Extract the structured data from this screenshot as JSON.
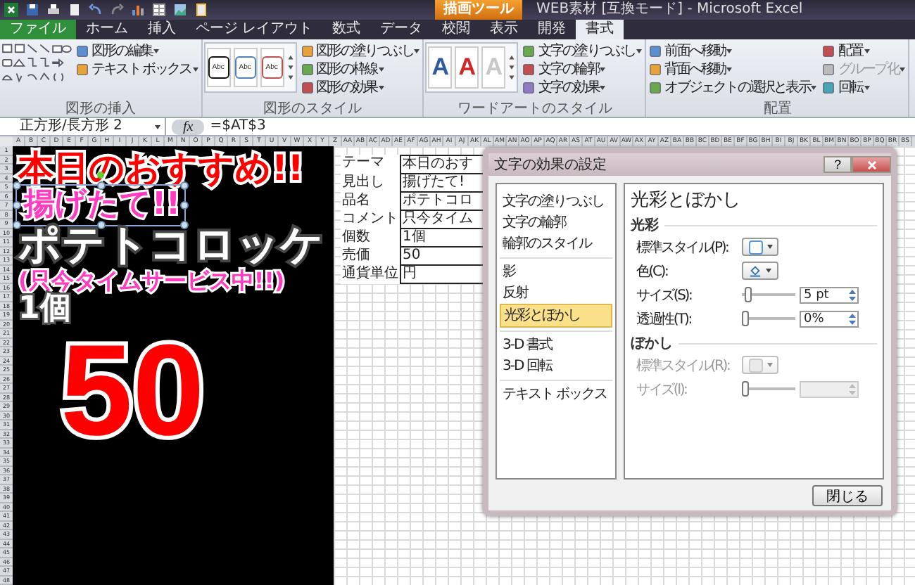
{
  "title_bar": {
    "context_tab": "描画ツール",
    "title": "WEB素材 [互換モード] - Microsoft Excel"
  },
  "tabs": [
    {
      "label": "ファイル",
      "kind": "file",
      "selected": false
    },
    {
      "label": "ホーム",
      "kind": "normal",
      "selected": false
    },
    {
      "label": "挿入",
      "kind": "normal",
      "selected": false
    },
    {
      "label": "ページ レイアウト",
      "kind": "normal",
      "selected": false
    },
    {
      "label": "数式",
      "kind": "normal",
      "selected": false
    },
    {
      "label": "データ",
      "kind": "normal",
      "selected": false
    },
    {
      "label": "校閲",
      "kind": "normal",
      "selected": false
    },
    {
      "label": "表示",
      "kind": "normal",
      "selected": false
    },
    {
      "label": "開発",
      "kind": "normal",
      "selected": false
    },
    {
      "label": "書式",
      "kind": "context",
      "selected": true
    }
  ],
  "ribbon": {
    "groups": [
      {
        "label": "図形の挿入",
        "kind": "shapes",
        "buttons": [
          {
            "label": "図形の編集"
          },
          {
            "label": "テキスト ボックス"
          }
        ]
      },
      {
        "label": "図形のスタイル",
        "kind": "styles",
        "swatches": [
          {
            "text": "Abc",
            "color": "#111111"
          },
          {
            "text": "Abc",
            "color": "#4f81bd"
          },
          {
            "text": "Abc",
            "color": "#c0504d"
          }
        ],
        "buttons": [
          {
            "label": "図形の塗りつぶし"
          },
          {
            "label": "図形の枠線"
          },
          {
            "label": "図形の効果"
          }
        ]
      },
      {
        "label": "ワードアートのスタイル",
        "kind": "wordart",
        "swatches": [
          {
            "text": "A",
            "color": "#2e5c9e"
          },
          {
            "text": "A",
            "color": "#d02828"
          },
          {
            "text": "A",
            "color": "#c8c8c8"
          }
        ],
        "buttons": [
          {
            "label": "文字の塗りつぶし"
          },
          {
            "label": "文字の輪郭"
          },
          {
            "label": "文字の効果"
          }
        ]
      },
      {
        "label": "配置",
        "kind": "arrange",
        "columns": [
          [
            {
              "label": "前面へ移動",
              "disabled": false
            },
            {
              "label": "背面へ移動",
              "disabled": false
            },
            {
              "label": "オブジェクトの選択と表示",
              "disabled": false
            }
          ],
          [
            {
              "label": "配置",
              "disabled": false
            },
            {
              "label": "グループ化",
              "disabled": true
            },
            {
              "label": "回転",
              "disabled": false
            }
          ]
        ]
      }
    ]
  },
  "formula_bar": {
    "name_box": "正方形/長方形 2",
    "function_button": "fx",
    "formula": "=$AT$3"
  },
  "sheet": {
    "columns": [
      "A",
      "B",
      "C",
      "D",
      "E",
      "F",
      "G",
      "H",
      "I",
      "J",
      "K",
      "L",
      "M",
      "N",
      "O",
      "P",
      "Q",
      "R",
      "S",
      "T",
      "U",
      "V",
      "W",
      "X",
      "Y",
      "Z",
      "AA",
      "AB",
      "AC",
      "AD",
      "AE",
      "AF",
      "AG",
      "AH",
      "AI",
      "AJ",
      "AK",
      "AL",
      "AM",
      "AN",
      "AO",
      "AP",
      "AQ",
      "AR",
      "AS",
      "AT",
      "AU",
      "AV",
      "AW",
      "AX",
      "AY",
      "AZ",
      "BA",
      "BB",
      "BC",
      "BD",
      "BE",
      "BF",
      "BG",
      "BH",
      "BI",
      "BJ",
      "BK",
      "BL",
      "BM",
      "BN",
      "BO",
      "BP",
      "BQ",
      "BR",
      "BS"
    ],
    "rows": [
      "1",
      "2",
      "3",
      "4",
      "5",
      "6",
      "7",
      "8",
      "9",
      "10",
      "11",
      "12",
      "13",
      "14",
      "15",
      "16",
      "17",
      "18",
      "19",
      "20",
      "21",
      "22",
      "23",
      "24",
      "25",
      "26",
      "27",
      "28",
      "29",
      "30",
      "31",
      "32",
      "33",
      "34",
      "35",
      "36",
      "37",
      "38",
      "39",
      "40",
      "41",
      "42",
      "43",
      "44",
      "45",
      "46",
      "47",
      "48"
    ],
    "poster": [
      {
        "text": "本日のおすすめ!!",
        "kind": "headline",
        "selected": false
      },
      {
        "text": "揚げたて!!",
        "kind": "tagline",
        "selected": true
      },
      {
        "text": "ポテトコロッケ",
        "kind": "product",
        "selected": false
      },
      {
        "text": "(只今タイムサービス中!!)",
        "kind": "note",
        "selected": false
      },
      {
        "text": "1個",
        "kind": "unit",
        "selected": false
      },
      {
        "text": "50",
        "kind": "price",
        "selected": false
      }
    ],
    "table": [
      {
        "label": "テーマ",
        "value": "本日のおす"
      },
      {
        "label": "見出し",
        "value": "揚げたて!"
      },
      {
        "label": "品名",
        "value": "ポテトコロ"
      },
      {
        "label": "コメント",
        "value": "只今タイム"
      },
      {
        "label": "個数",
        "value": "1個"
      },
      {
        "label": "売価",
        "value": "50"
      },
      {
        "label": "通貨単位",
        "value": "円"
      }
    ]
  },
  "dialog": {
    "title": "文字の効果の設定",
    "help": "?",
    "categories": [
      [
        {
          "label": "文字の塗りつぶし",
          "selected": false
        },
        {
          "label": "文字の輪郭",
          "selected": false
        },
        {
          "label": "輪郭のスタイル",
          "selected": false
        }
      ],
      [
        {
          "label": "影",
          "selected": false
        },
        {
          "label": "反射",
          "selected": false
        },
        {
          "label": "光彩とぼかし",
          "selected": true
        }
      ],
      [
        {
          "label": "3-D 書式",
          "selected": false
        },
        {
          "label": "3-D 回転",
          "selected": false
        }
      ],
      [
        {
          "label": "テキスト ボックス",
          "selected": false
        }
      ]
    ],
    "heading": "光彩とぼかし",
    "sections": [
      {
        "title": "光彩",
        "rows": [
          {
            "kind": "swatch",
            "label": "標準スタイル(P):",
            "disabled": false
          },
          {
            "kind": "color",
            "label": "色(C):",
            "disabled": false
          },
          {
            "kind": "slider",
            "label": "サイズ(S):",
            "disabled": false,
            "level": 0.05,
            "value": "5 pt"
          },
          {
            "kind": "slider",
            "label": "透過性(T):",
            "disabled": false,
            "level": 0,
            "value": "0%"
          }
        ]
      },
      {
        "title": "ぼかし",
        "rows": [
          {
            "kind": "swatch",
            "label": "標準スタイル(R):",
            "disabled": true
          },
          {
            "kind": "slider",
            "label": "サイズ(I):",
            "disabled": true,
            "level": 0
          }
        ]
      }
    ],
    "close_button": "閉じる"
  }
}
